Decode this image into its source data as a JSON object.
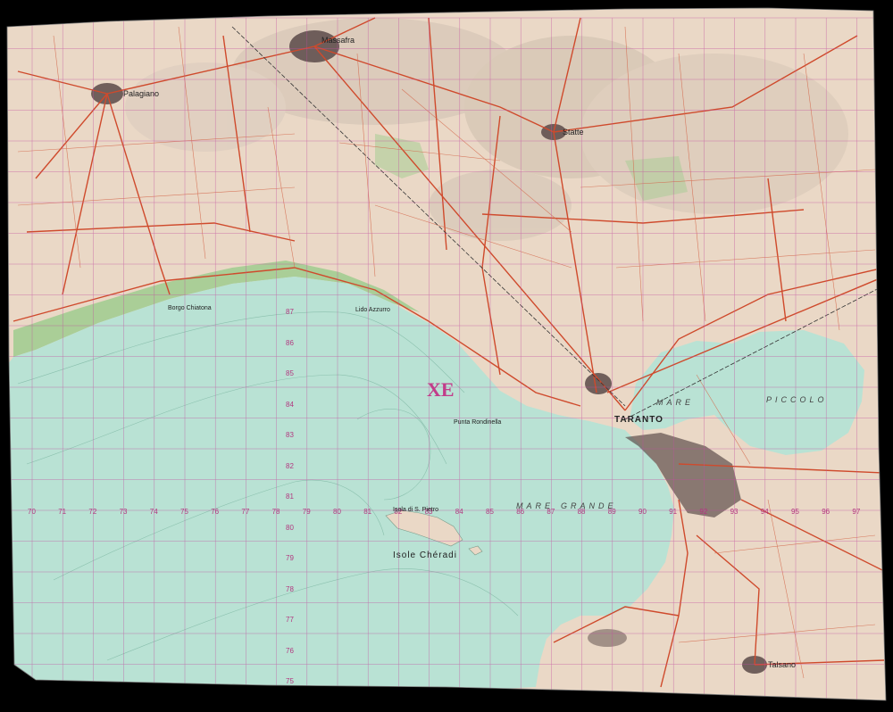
{
  "map": {
    "grid_zone_label": "XE",
    "grid_x_labels": [
      "70",
      "71",
      "72",
      "73",
      "74",
      "75",
      "76",
      "77",
      "78",
      "79",
      "80",
      "81",
      "82",
      "83",
      "84",
      "85",
      "86",
      "87",
      "88",
      "89",
      "90",
      "91",
      "92",
      "93",
      "94",
      "95",
      "96",
      "97"
    ],
    "grid_y_labels": [
      "87",
      "86",
      "85",
      "84",
      "83",
      "82",
      "81",
      "80",
      "79",
      "78",
      "77",
      "76",
      "75"
    ],
    "places": {
      "taranto": "TARANTO",
      "mare_piccolo": "PICCOLO",
      "mare_top": "MARE",
      "mare_grande_1": "MARE",
      "mare_grande_2": "GRANDE",
      "isole": "Isole Chéradi",
      "massafra": "Massafra",
      "palagiano": "Palagiano",
      "statte": "Statte",
      "talsano": "Talsano",
      "punta_rondinella": "Punta Rondinella",
      "lido_azzurro": "Lido Azzurro",
      "san_pietro": "Isola di S. Pietro",
      "chiatona": "Borgo Chiatona"
    },
    "colors": {
      "sea": "#b9e2d4",
      "land": "#ead8c6",
      "road": "#cf4a2c",
      "grid": "#c24fa0",
      "vegetation": "#9fcc8e",
      "urban": "#5a4a48"
    }
  }
}
